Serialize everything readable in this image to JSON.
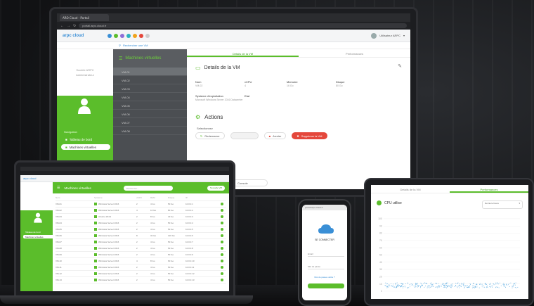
{
  "monitor": {
    "browser": {
      "tab_title": "ARO Cloud - Portail",
      "url": "portail.arpc.cloud.fr"
    },
    "app": {
      "logo_text": "arpc cloud",
      "user_name": "Utilisateur ARPC",
      "app_icon_colors": [
        "#3a8fd6",
        "#5bbd2b",
        "#8e6fd8",
        "#2bb3c0",
        "#f0a31b",
        "#e4473b",
        "#ccc"
      ]
    },
    "sidebar": {
      "company": "Societe ARPC",
      "role": "Administrateur",
      "section_label": "Navigation",
      "items": [
        {
          "label": "Tableau de bord",
          "active": false
        },
        {
          "label": "Machines virtuelles",
          "active": true
        }
      ]
    },
    "search_text": "Rechercher une VM",
    "vm_list": {
      "title": "Machines virtuelles",
      "rows": [
        "VM-01",
        "VM-02",
        "VM-03",
        "VM-04",
        "VM-05",
        "VM-06",
        "VM-07",
        "VM-08"
      ]
    },
    "detail": {
      "tabs": [
        "Details de la VM",
        "Performances"
      ],
      "active_tab": 0,
      "title": "Details de la VM",
      "fields": [
        {
          "label": "Nom",
          "value": "VM-02"
        },
        {
          "label": "vCPU",
          "value": "4"
        },
        {
          "label": "Memoire",
          "value": "16 Go"
        },
        {
          "label": "Disque",
          "value": "80 Go"
        },
        {
          "label": "Systeme d'exploitation",
          "value": "Microsoft Windows Server 2016 Datacenter"
        },
        {
          "label": "Etat",
          "value": ""
        }
      ],
      "actions_title": "Actions",
      "actions_sub": "Selectionnez",
      "actions": [
        {
          "label": "Redemarrer",
          "style": "normal"
        },
        {
          "label": "",
          "style": "ghost"
        },
        {
          "label": "Arreter",
          "style": "normal"
        },
        {
          "label": "Supprimer la VM",
          "style": "red"
        }
      ],
      "console_label": "Console"
    }
  },
  "laptop": {
    "header_title": "Machines virtuelles",
    "search_placeholder": "Rechercher...",
    "new_button": "Nouvelle VM",
    "columns": [
      "Nom",
      "Systeme",
      "vCPU",
      "RAM",
      "Disque",
      "IP",
      "",
      ""
    ],
    "rows": [
      [
        "VM-01",
        "Windows Server 2016",
        "2",
        "4 Go",
        "50 Go",
        "10.0.0.1"
      ],
      [
        "VM-02",
        "Windows Server 2016",
        "4",
        "16 Go",
        "80 Go",
        "10.0.0.2"
      ],
      [
        "VM-03",
        "Ubuntu 18.04",
        "2",
        "8 Go",
        "40 Go",
        "10.0.0.3"
      ],
      [
        "VM-04",
        "Windows Server 2016",
        "2",
        "4 Go",
        "50 Go",
        "10.0.0.4"
      ],
      [
        "VM-05",
        "Windows Server 2016",
        "2",
        "4 Go",
        "50 Go",
        "10.0.0.5"
      ],
      [
        "VM-06",
        "Windows Server 2016",
        "8",
        "32 Go",
        "120 Go",
        "10.0.0.6"
      ],
      [
        "VM-07",
        "Windows Server 2016",
        "2",
        "4 Go",
        "50 Go",
        "10.0.0.7"
      ],
      [
        "VM-08",
        "Windows Server 2016",
        "2",
        "4 Go",
        "50 Go",
        "10.0.0.8"
      ],
      [
        "VM-09",
        "Windows Server 2016",
        "2",
        "4 Go",
        "50 Go",
        "10.0.0.9"
      ],
      [
        "VM-10",
        "Windows Server 2016",
        "4",
        "8 Go",
        "60 Go",
        "10.0.0.10"
      ],
      [
        "VM-11",
        "Windows Server 2016",
        "2",
        "4 Go",
        "50 Go",
        "10.0.0.11"
      ],
      [
        "VM-12",
        "Windows Server 2016",
        "2",
        "4 Go",
        "50 Go",
        "10.0.0.12"
      ],
      [
        "VM-13",
        "Windows Server 2016",
        "2",
        "4 Go",
        "50 Go",
        "10.0.0.13"
      ]
    ],
    "sidebar_items": [
      "Tableau de bord",
      "Machines virtuelles"
    ]
  },
  "phone": {
    "url": "portail.arpc.cloud.fr",
    "title": "SE CONNECTER",
    "field_email": "Email",
    "field_password": "Mot de passe",
    "forgot": "Mot de passe oublie ?"
  },
  "tablet": {
    "tabs": [
      "Details de la VM",
      "Performances"
    ],
    "active_tab": 1,
    "chart_title": "CPU utilise",
    "select_value": "Derniere heure",
    "chart_data": {
      "type": "scatter",
      "title": "CPU utilise",
      "xlabel": "",
      "ylabel": "",
      "ylim": [
        0,
        100
      ],
      "ticks_y": [
        "100",
        "90",
        "80",
        "70",
        "60",
        "50",
        "40",
        "30",
        "20",
        "10",
        "0"
      ],
      "series": [
        {
          "values_range": [
            5,
            12
          ],
          "color": "#4aa3df"
        }
      ]
    }
  }
}
